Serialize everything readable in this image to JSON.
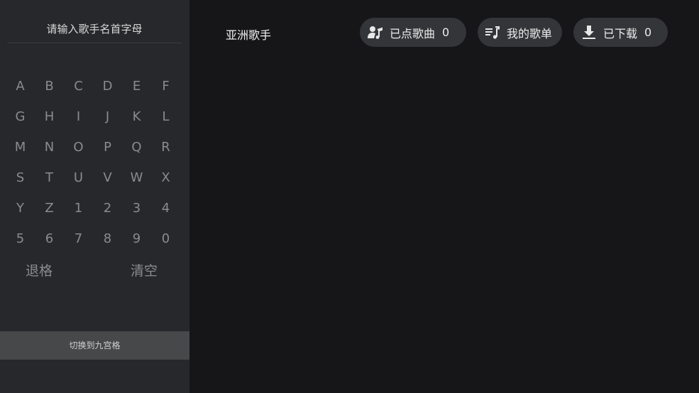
{
  "left_panel": {
    "search_prompt": "请输入歌手名首字母",
    "keyboard_rows": [
      [
        "A",
        "B",
        "C",
        "D",
        "E",
        "F"
      ],
      [
        "G",
        "H",
        "I",
        "J",
        "K",
        "L"
      ],
      [
        "M",
        "N",
        "O",
        "P",
        "Q",
        "R"
      ],
      [
        "S",
        "T",
        "U",
        "V",
        "W",
        "X"
      ],
      [
        "Y",
        "Z",
        "1",
        "2",
        "3",
        "4"
      ],
      [
        "5",
        "6",
        "7",
        "8",
        "9",
        "0"
      ]
    ],
    "backspace_label": "退格",
    "clear_label": "清空",
    "switch_label": "切换到九宫格"
  },
  "main": {
    "title": "亚洲歌手",
    "played": {
      "label": "已点歌曲",
      "count": "0",
      "icon": "singer-note-icon"
    },
    "playlist": {
      "label": "我的歌单",
      "icon": "playlist-icon"
    },
    "downloaded": {
      "label": "已下载",
      "count": "0",
      "icon": "download-icon"
    }
  }
}
